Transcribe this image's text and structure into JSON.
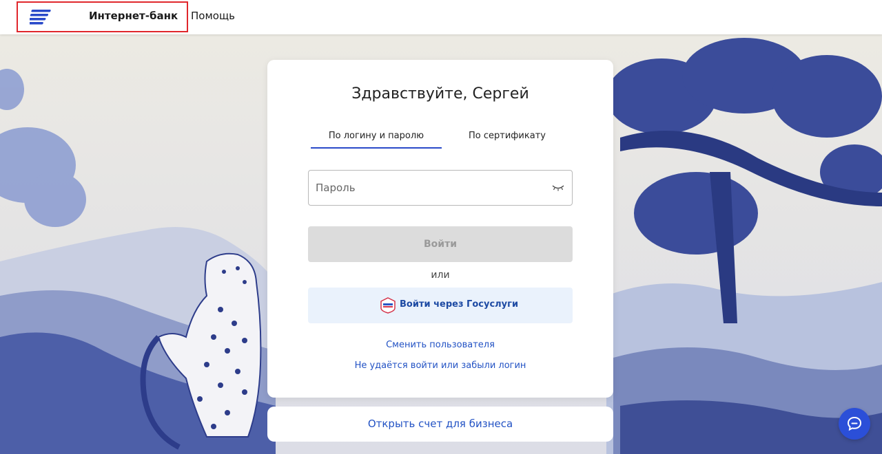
{
  "header": {
    "title": "Интернет-банк",
    "help": "Помощь"
  },
  "login": {
    "greeting": "Здравствуйте, Сергей",
    "tabs": [
      {
        "label": "По логину и паролю",
        "active": true
      },
      {
        "label": "По сертификату",
        "active": false
      }
    ],
    "password_placeholder": "Пароль",
    "submit": "Войти",
    "or": "или",
    "gosuslugi": "Войти через Госуслуги",
    "switch_user": "Сменить пользователя",
    "forgot": "Не удаётся войти или забыли логин"
  },
  "business": {
    "label": "Открыть счет для бизнеса"
  },
  "icons": {
    "logo": "bank-logo-icon",
    "eye": "eye-closed-icon",
    "gosuslugi": "gosuslugi-icon",
    "chat": "chat-icon"
  },
  "colors": {
    "accent": "#2949c9",
    "link": "#2252c4",
    "highlight_border": "#e0262b"
  }
}
